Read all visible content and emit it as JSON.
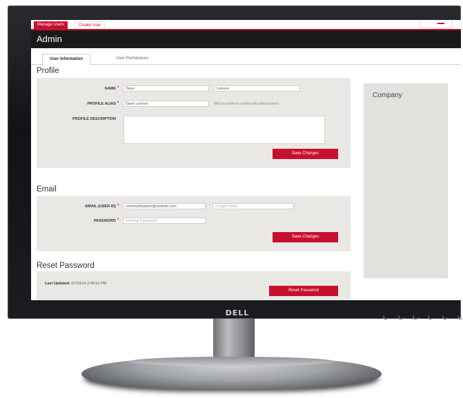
{
  "top_nav": {
    "tabs": [
      {
        "label": "Manage Users",
        "active": true
      },
      {
        "label": "Create User",
        "active": false
      }
    ]
  },
  "admin_bar": {
    "title": "Admin"
  },
  "sub_tabs": [
    {
      "label": "User Information",
      "active": true
    },
    {
      "label": "User Permissions",
      "active": false
    }
  ],
  "profile": {
    "section_title": "Profile",
    "name_label": "NAME",
    "first_name": "Dave",
    "last_name": "Lennox",
    "alias_label": "PROFILE ALIAS",
    "alias_value": "Dave Lennox",
    "alias_hint": "Will be used in community discussions",
    "description_label": "PROFILE DESCRIPTION",
    "description_value": "",
    "save_label": "Save Changes",
    "required_marker": "*"
  },
  "email": {
    "section_title": "Email",
    "email_label": "EMAIL (USER ID)",
    "email_value": "communitydave@outlook.com",
    "retype_placeholder": "re-type email",
    "password_label": "PASSWORD",
    "password_placeholder": "Existing Password",
    "save_label": "Save Changes"
  },
  "reset_password": {
    "section_title": "Reset Password",
    "last_updated_label": "Last Updated:",
    "last_updated_value": "5/7/2014 2:00:51 PM",
    "button_label": "Reset Password"
  },
  "company": {
    "title": "Company"
  },
  "monitor": {
    "brand": "DELL"
  },
  "colors": {
    "accent": "#c8102e",
    "admin_bar": "#1a1a1a",
    "panel": "#e9e8e5"
  }
}
